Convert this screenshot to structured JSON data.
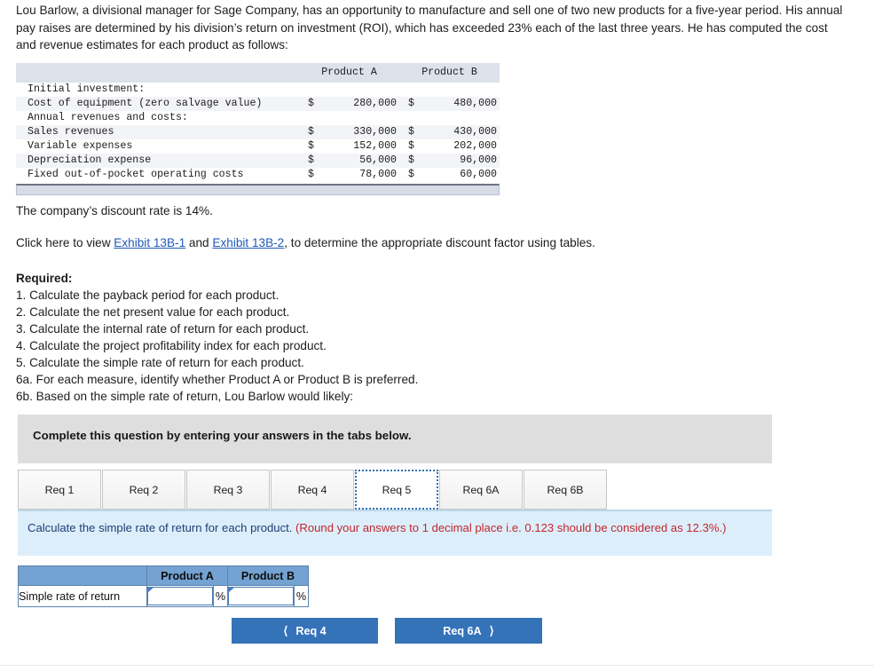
{
  "intro": {
    "paragraph": "Lou Barlow, a divisional manager for Sage Company, has an opportunity to manufacture and sell one of two new products for a five-year period. His annual pay raises are determined by his division’s return on investment (ROI), which has exceeded 23% each of the last three years. He has computed the cost and revenue estimates for each product as follows:"
  },
  "fin_table": {
    "columns": [
      "",
      "Product A",
      "Product B"
    ],
    "rows": [
      {
        "label": "Initial investment:",
        "a_cur": "",
        "a": "",
        "b_cur": "",
        "b": ""
      },
      {
        "label": "Cost of equipment (zero salvage value)",
        "a_cur": "$",
        "a": "280,000",
        "b_cur": "$",
        "b": "480,000"
      },
      {
        "label": "Annual revenues and costs:",
        "a_cur": "",
        "a": "",
        "b_cur": "",
        "b": ""
      },
      {
        "label": "Sales revenues",
        "a_cur": "$",
        "a": "330,000",
        "b_cur": "$",
        "b": "430,000"
      },
      {
        "label": "Variable expenses",
        "a_cur": "$",
        "a": "152,000",
        "b_cur": "$",
        "b": "202,000"
      },
      {
        "label": "Depreciation expense",
        "a_cur": "$",
        "a": "56,000",
        "b_cur": "$",
        "b": "96,000"
      },
      {
        "label": "Fixed out-of-pocket operating costs",
        "a_cur": "$",
        "a": "78,000",
        "b_cur": "$",
        "b": "60,000"
      }
    ]
  },
  "discount_line": "The company’s discount rate is 14%.",
  "exhibit_line": {
    "pre": "Click here to view ",
    "link1": "Exhibit 13B-1",
    "mid": " and ",
    "link2": "Exhibit 13B-2",
    "post": ", to determine the appropriate discount factor using tables."
  },
  "required": {
    "title": "Required:",
    "items": [
      "1. Calculate the payback period for each product.",
      "2. Calculate the net present value for each product.",
      "3. Calculate the internal rate of return for each product.",
      "4. Calculate the project profitability index for each product.",
      "5. Calculate the simple rate of return for each product.",
      "6a. For each measure, identify whether Product A or Product B is preferred.",
      "6b. Based on the simple rate of return, Lou Barlow would likely:"
    ]
  },
  "banner": {
    "text": "Complete this question by entering your answers in the tabs below."
  },
  "tabs": [
    {
      "label": "Req 1",
      "active": false
    },
    {
      "label": "Req 2",
      "active": false
    },
    {
      "label": "Req 3",
      "active": false
    },
    {
      "label": "Req 4",
      "active": false
    },
    {
      "label": "Req 5",
      "active": true
    },
    {
      "label": "Req 6A",
      "active": false
    },
    {
      "label": "Req 6B",
      "active": false
    }
  ],
  "question_panel": {
    "prompt": "Calculate the simple rate of return for each product. ",
    "hint": "(Round your answers to 1 decimal place i.e. 0.123 should be considered as 12.3%.)"
  },
  "answer_table": {
    "headers": [
      "",
      "Product A",
      "Product B"
    ],
    "row_label": "Simple rate of return",
    "product_a_value": "",
    "product_b_value": "",
    "percent_suffix": "%"
  },
  "nav": {
    "prev_label": "Req 4",
    "prev_icon": "chevron-left-icon",
    "next_label": "Req 6A",
    "next_icon": "chevron-right-icon"
  },
  "colors": {
    "accent_blue": "#3573b9",
    "link_blue": "#2159b8",
    "panel_blue": "#ddeefb",
    "hint_red": "#c0272d",
    "table_header": "#74a2d2",
    "banner_grey": "#dedede"
  }
}
